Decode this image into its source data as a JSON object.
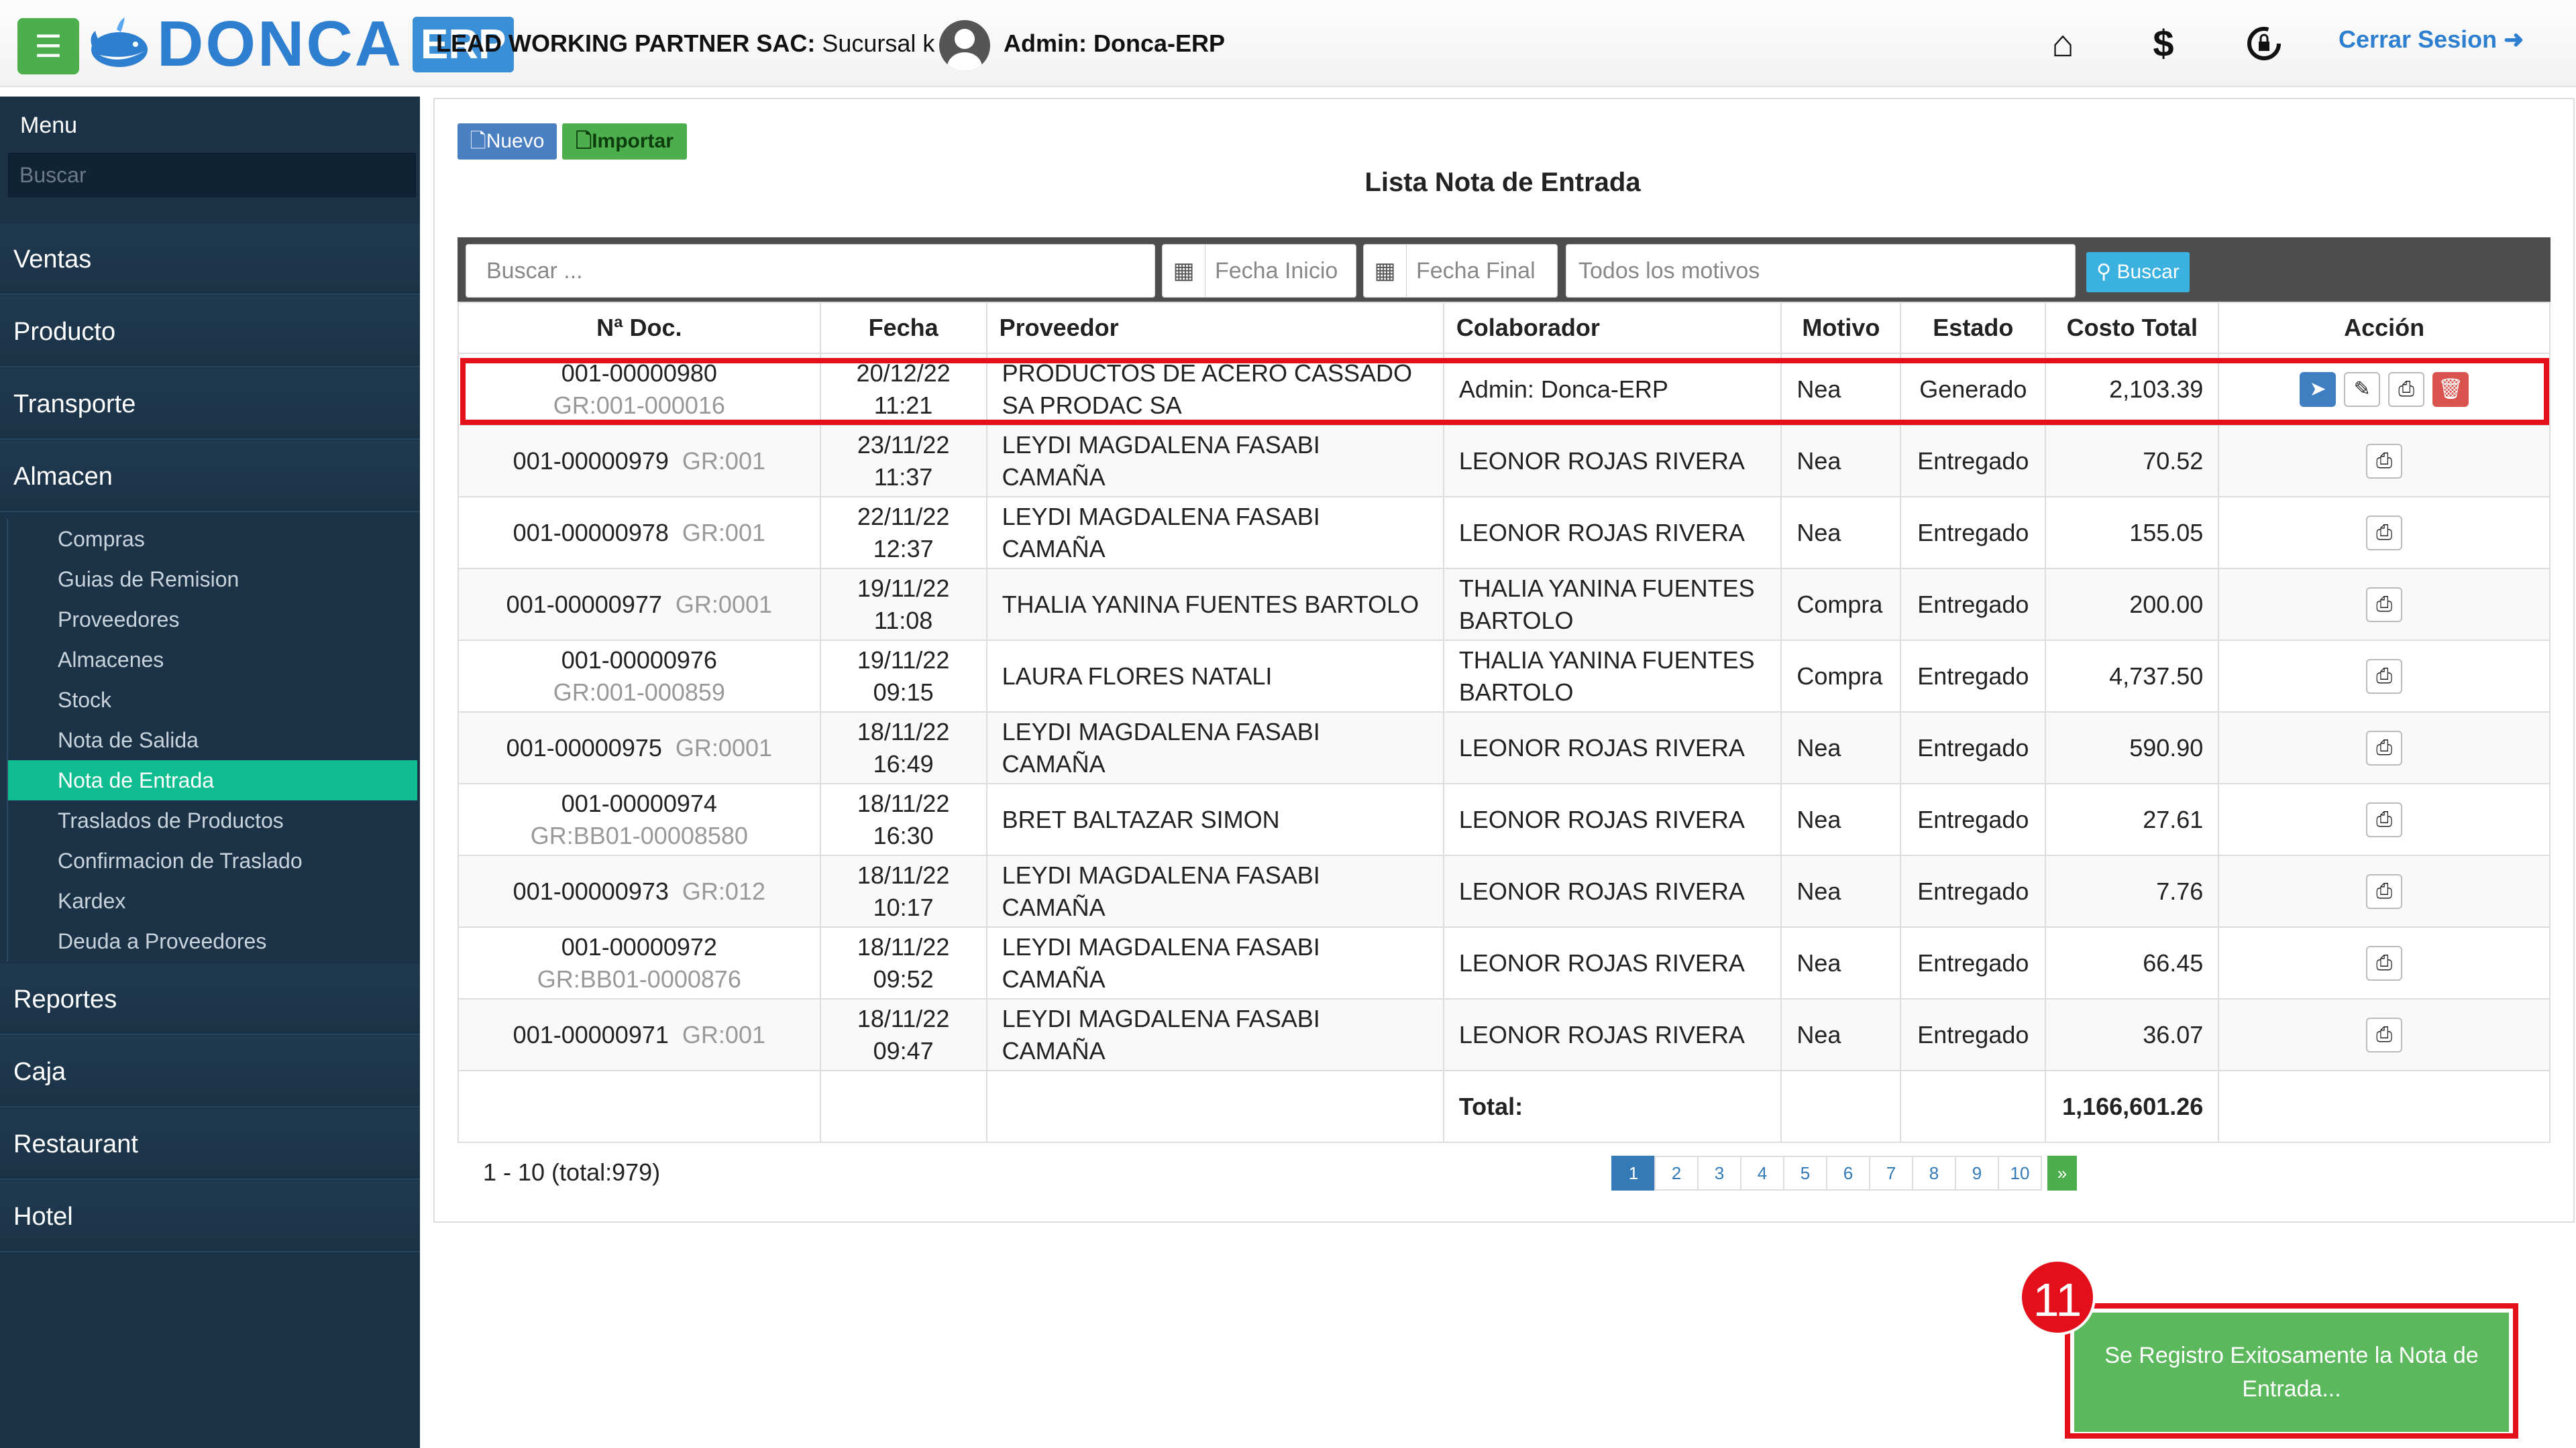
{
  "header": {
    "menu_icon": "hamburger-icon",
    "logo_name": "DONCA",
    "logo_erp": "ERP",
    "company_bold": "LEAD WORKING PARTNER SAC:",
    "company_rest": " Sucursal k |",
    "admin": "Admin: Donca-ERP",
    "icons": [
      "home-icon",
      "dollar-icon",
      "lock-refresh-icon"
    ],
    "logout": "Cerrar Sesion"
  },
  "sidebar": {
    "title": "Menu",
    "search_placeholder": "Buscar",
    "items": [
      "Ventas",
      "Producto",
      "Transporte",
      "Almacen",
      "Reportes",
      "Caja",
      "Restaurant",
      "Hotel"
    ],
    "almacen_sub": [
      "Compras",
      "Guias de Remision",
      "Proveedores",
      "Almacenes",
      "Stock",
      "Nota de Salida",
      "Nota de Entrada",
      "Traslados de Productos",
      "Confirmacion de Traslado",
      "Kardex",
      "Deuda a Proveedores"
    ],
    "active_sub": "Nota de Entrada"
  },
  "toolbar": {
    "nuevo": "Nuevo",
    "importar": "Importar"
  },
  "page_title": "Lista Nota de Entrada",
  "filters": {
    "search_placeholder": "Buscar ...",
    "fecha_inicio": "Fecha Inicio",
    "fecha_final": "Fecha Final",
    "motivo": "Todos los motivos",
    "buscar": "Buscar"
  },
  "table": {
    "headers": [
      "Nª Doc.",
      "Fecha",
      "Proveedor",
      "Colaborador",
      "Motivo",
      "Estado",
      "Costo Total",
      "Acción"
    ],
    "rows": [
      {
        "doc": "001-00000980",
        "gr": "GR:001-000016",
        "date": "20/12/22",
        "time": "11:21",
        "proveedor": "PRODUCTOS DE ACERO CASSADO SA PRODAC SA",
        "colaborador": "Admin: Donca-ERP",
        "motivo": "Nea",
        "estado": "Generado",
        "costo": "2,103.39"
      },
      {
        "doc": "001-00000979",
        "gr": "GR:001",
        "date": "23/11/22",
        "time": "11:37",
        "proveedor": "LEYDI MAGDALENA FASABI CAMAÑA",
        "colaborador": "LEONOR ROJAS RIVERA",
        "motivo": "Nea",
        "estado": "Entregado",
        "costo": "70.52"
      },
      {
        "doc": "001-00000978",
        "gr": "GR:001",
        "date": "22/11/22",
        "time": "12:37",
        "proveedor": "LEYDI MAGDALENA FASABI CAMAÑA",
        "colaborador": "LEONOR ROJAS RIVERA",
        "motivo": "Nea",
        "estado": "Entregado",
        "costo": "155.05"
      },
      {
        "doc": "001-00000977",
        "gr": "GR:0001",
        "date": "19/11/22",
        "time": "11:08",
        "proveedor": "THALIA YANINA FUENTES BARTOLO",
        "colaborador": "THALIA YANINA FUENTES BARTOLO",
        "motivo": "Compra",
        "estado": "Entregado",
        "costo": "200.00"
      },
      {
        "doc": "001-00000976",
        "gr": "GR:001-000859",
        "date": "19/11/22",
        "time": "09:15",
        "proveedor": "LAURA FLORES NATALI",
        "colaborador": "THALIA YANINA FUENTES BARTOLO",
        "motivo": "Compra",
        "estado": "Entregado",
        "costo": "4,737.50"
      },
      {
        "doc": "001-00000975",
        "gr": "GR:0001",
        "date": "18/11/22",
        "time": "16:49",
        "proveedor": "LEYDI MAGDALENA FASABI CAMAÑA",
        "colaborador": "LEONOR ROJAS RIVERA",
        "motivo": "Nea",
        "estado": "Entregado",
        "costo": "590.90"
      },
      {
        "doc": "001-00000974",
        "gr": "GR:BB01-00008580",
        "date": "18/11/22",
        "time": "16:30",
        "proveedor": "BRET BALTAZAR SIMON",
        "colaborador": "LEONOR ROJAS RIVERA",
        "motivo": "Nea",
        "estado": "Entregado",
        "costo": "27.61"
      },
      {
        "doc": "001-00000973",
        "gr": "GR:012",
        "date": "18/11/22",
        "time": "10:17",
        "proveedor": "LEYDI MAGDALENA FASABI CAMAÑA",
        "colaborador": "LEONOR ROJAS RIVERA",
        "motivo": "Nea",
        "estado": "Entregado",
        "costo": "7.76"
      },
      {
        "doc": "001-00000972",
        "gr": "GR:BB01-0000876",
        "date": "18/11/22",
        "time": "09:52",
        "proveedor": "LEYDI MAGDALENA FASABI CAMAÑA",
        "colaborador": "LEONOR ROJAS RIVERA",
        "motivo": "Nea",
        "estado": "Entregado",
        "costo": "66.45"
      },
      {
        "doc": "001-00000971",
        "gr": "GR:001",
        "date": "18/11/22",
        "time": "09:47",
        "proveedor": "LEYDI MAGDALENA FASABI CAMAÑA",
        "colaborador": "LEONOR ROJAS RIVERA",
        "motivo": "Nea",
        "estado": "Entregado",
        "costo": "36.07"
      }
    ],
    "total_label": "Total:",
    "total_value": "1,166,601.26"
  },
  "pagination": {
    "info": "1 - 10 (total:979)",
    "pages": [
      "1",
      "2",
      "3",
      "4",
      "5",
      "6",
      "7",
      "8",
      "9",
      "10"
    ],
    "next": "»",
    "current": "1"
  },
  "toast": {
    "badge": "11",
    "message": "Se Registro Exitosamente la Nota de Entrada..."
  },
  "colors": {
    "sidebar": "#1c3347",
    "active": "#0fbd91",
    "highlight": "#e3101b",
    "success": "#5cb85c"
  }
}
